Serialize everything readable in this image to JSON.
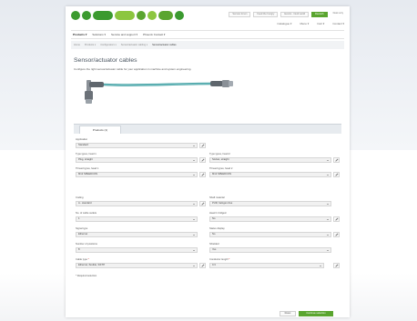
{
  "header": {
    "top_links": [
      "Service forum",
      "Feed the hungry",
      "Events · Nerd world",
      "Desk only"
    ],
    "top_link_green": "Deutsch",
    "util_items": [
      "Catalogue ▾",
      "Menu ▾",
      "Cart ▾",
      "Contact ▾"
    ]
  },
  "mainnav": {
    "items": [
      "Products ▾",
      "Solutions ▾",
      "Service and support ▾",
      "Phoenix Contact ▾"
    ]
  },
  "breadcrumb": {
    "items": [
      "Home",
      "Products ▾",
      "Configurators ▾",
      "Sensor/actuator cabling ▾"
    ],
    "current": "Sensor/actuator cables"
  },
  "page": {
    "title": "Sensor/actuator cables",
    "intro": "Configure the right sensor/actuator cable for your application in machine and system engineering."
  },
  "form": {
    "tab_label": "Products (1)",
    "fields": {
      "application": {
        "label": "Application",
        "value": "Standard"
      },
      "type_head1": {
        "label": "Type types, head 1",
        "value": "Plug, straight"
      },
      "type_head2": {
        "label": "Type types, head 2",
        "value": "Socket, straight"
      },
      "thread_head1": {
        "label": "Thread types, head 1",
        "value": "M12 SPEEDCON"
      },
      "thread_head2": {
        "label": "Thread types, head 2",
        "value": "M12 SPEEDCON"
      },
      "coding": {
        "label": "Coding",
        "value": "A - standard"
      },
      "shaft_material": {
        "label": "Shaft material",
        "value": "PUR, halogen-free"
      },
      "cable_outlets": {
        "label": "No. of cable outlets",
        "value": "1"
      },
      "head_bridged": {
        "label": "Head 1 bridged",
        "value": "No"
      },
      "signal_type": {
        "label": "Signal type",
        "value": "Ethernet"
      },
      "status_display": {
        "label": "Status display",
        "value": "No"
      },
      "positions": {
        "label": "Number of positions",
        "value": "8"
      },
      "shielded": {
        "label": "Shielded",
        "value": "Yes"
      },
      "cable_type": {
        "label": "Cable type",
        "value": "Ethernet, flexible, S/FTP"
      },
      "conductor_length": {
        "label": "Conductor length",
        "value": "0.3"
      }
    },
    "required_mark": "*",
    "footnote": "* Required selection",
    "reset_label": "Reset",
    "submit_label": "Continue selection"
  },
  "colors": {
    "brand_green": "#5aa52f",
    "cable_teal": "#4aa3a6",
    "title_color": "#4a5560"
  },
  "icons": [
    "edit-icon",
    "chevron-down-icon"
  ]
}
